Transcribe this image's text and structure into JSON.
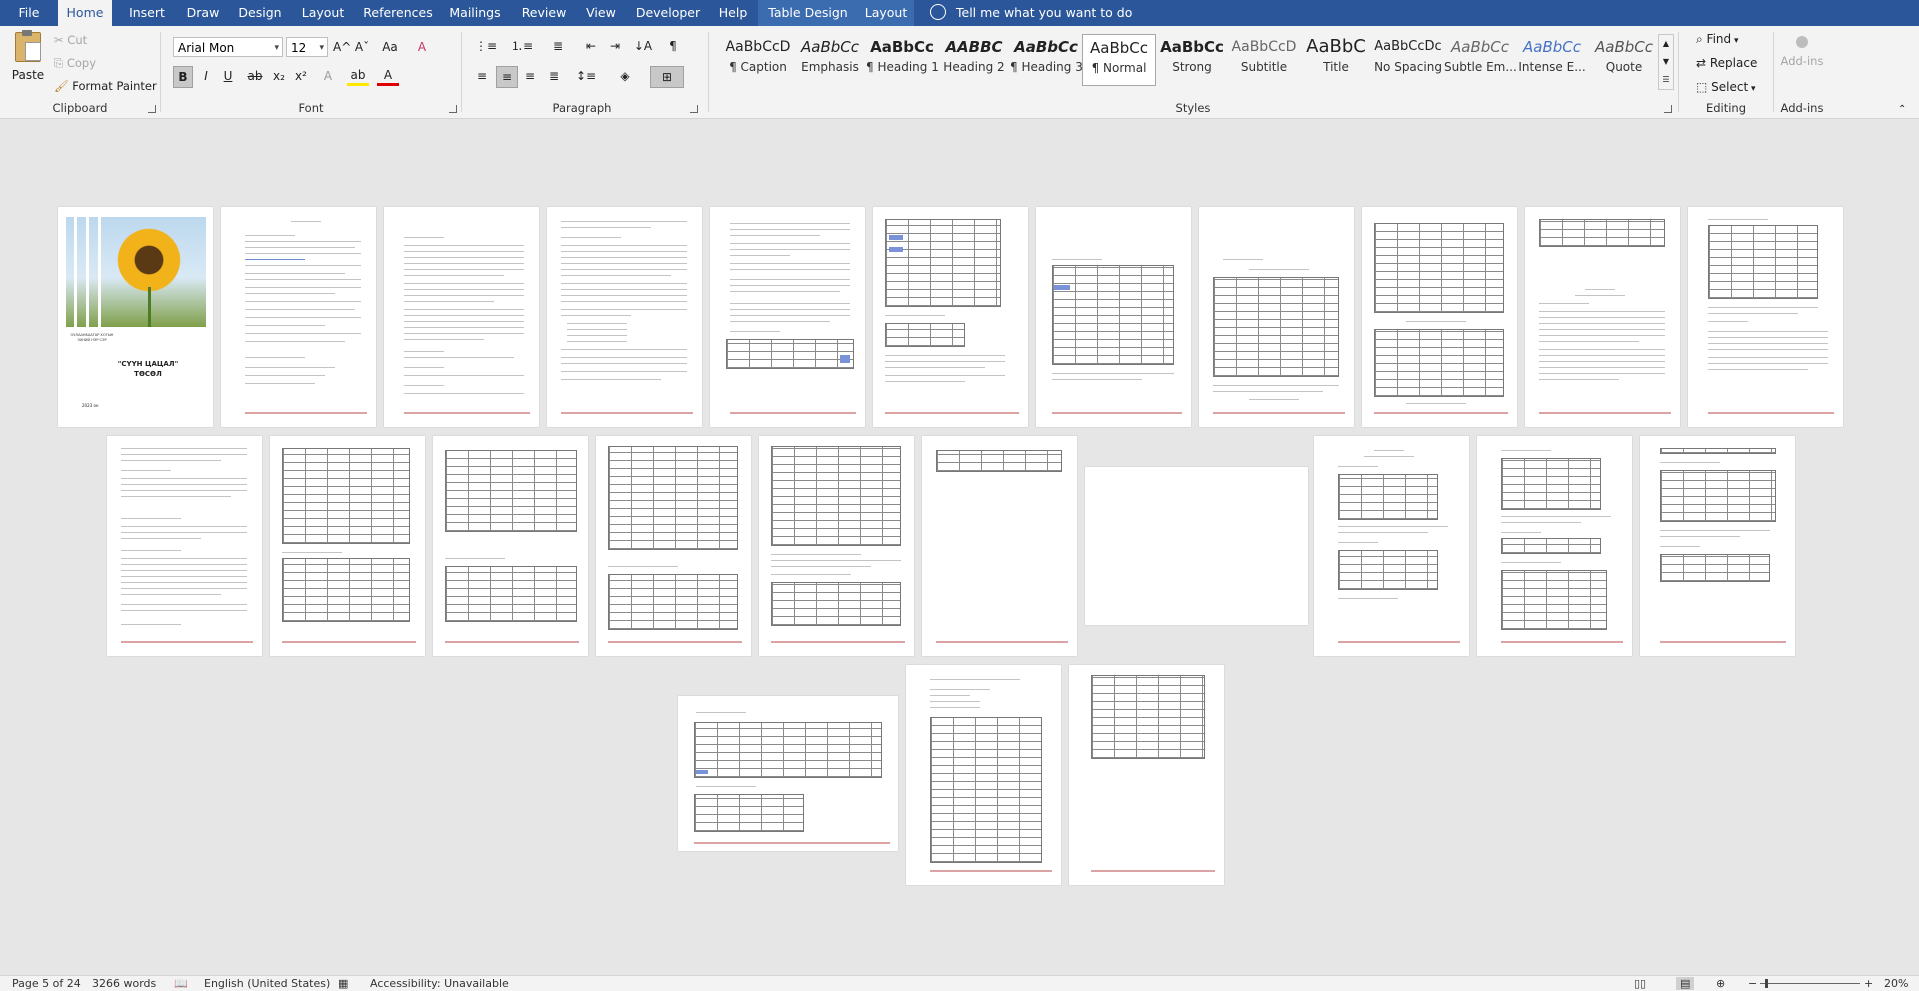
{
  "ribbon_tabs": [
    "File",
    "Home",
    "Insert",
    "Draw",
    "Design",
    "Layout",
    "References",
    "Mailings",
    "Review",
    "View",
    "Developer",
    "Help",
    "Table Design",
    "Layout"
  ],
  "tell_me": "Tell me what you want to do",
  "clipboard": {
    "paste": "Paste",
    "cut": "Cut",
    "copy": "Copy",
    "format_painter": "Format Painter",
    "label": "Clipboard"
  },
  "font": {
    "name": "Arial Mon",
    "size": "12",
    "label": "Font",
    "bold": "B",
    "italic": "I",
    "underline": "U",
    "strike": "ab",
    "sub": "x₂",
    "sup": "x²",
    "case": "Aa",
    "grow": "A^",
    "shrink": "Aˇ",
    "clear": "A",
    "effects": "A",
    "highlight": "ab",
    "color": "A"
  },
  "paragraph": {
    "label": "Paragraph",
    "pilcrow": "¶"
  },
  "styles": {
    "label": "Styles",
    "items": [
      {
        "preview": "AaBbCcD",
        "name": "¶ Caption"
      },
      {
        "preview": "AaBbCc",
        "name": "Emphasis"
      },
      {
        "preview": "AaBbCc",
        "name": "¶ Heading 1"
      },
      {
        "preview": "AABBC",
        "name": "Heading 2"
      },
      {
        "preview": "AaBbCc",
        "name": "¶ Heading 3"
      },
      {
        "preview": "AaBbCc",
        "name": "¶ Normal"
      },
      {
        "preview": "AaBbCc",
        "name": "Strong"
      },
      {
        "preview": "AaBbCcD",
        "name": "Subtitle"
      },
      {
        "preview": "AaBbC",
        "name": "Title"
      },
      {
        "preview": "AaBbCcDc",
        "name": "No Spacing"
      },
      {
        "preview": "AaBbCc",
        "name": "Subtle Em..."
      },
      {
        "preview": "AaBbCc",
        "name": "Intense E..."
      },
      {
        "preview": "AaBbCc",
        "name": "Quote"
      }
    ]
  },
  "editing": {
    "label": "Editing",
    "find": "Find",
    "replace": "Replace",
    "select": "Select"
  },
  "addins": {
    "label": "Add-ins",
    "button": "Add-ins"
  },
  "cover": {
    "line1": "ОУЛААНБААТАР ХОТЫН",
    "line2": "ЭХНИЙ НЭР СЭР",
    "title1": "\"СҮҮН ЦАЦАЛ\"",
    "title2": "ТӨСӨЛ",
    "year": "2023 он"
  },
  "status": {
    "page": "Page 5 of 24",
    "words": "3266 words",
    "language": "English (United States)",
    "accessibility": "Accessibility: Unavailable",
    "zoom": "20%"
  }
}
